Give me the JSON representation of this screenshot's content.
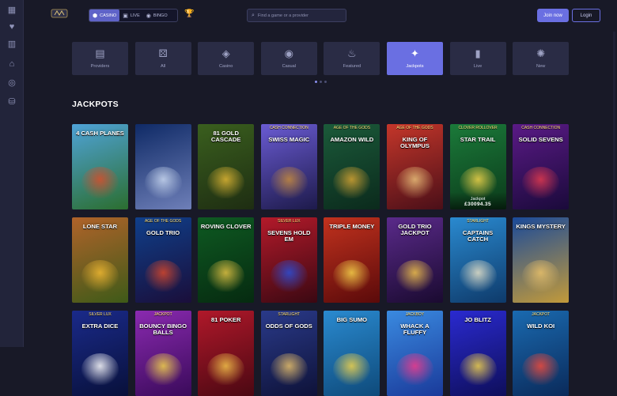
{
  "sidebar": {
    "icons": [
      "dashboard-icon",
      "heart-icon",
      "building-icon",
      "gift-icon",
      "chip-icon",
      "coins-icon"
    ]
  },
  "header": {
    "modes": [
      {
        "label": "CASINO",
        "icon": "casino-icon",
        "active": true
      },
      {
        "label": "LIVE",
        "icon": "cards-icon",
        "active": false
      },
      {
        "label": "BINGO",
        "icon": "bingo-icon",
        "active": false
      }
    ],
    "search_placeholder": "Find a game or a provider",
    "join_label": "Join now",
    "login_label": "Login"
  },
  "categories": [
    {
      "label": "Providers",
      "icon": "briefcase-icon",
      "active": false
    },
    {
      "label": "All",
      "icon": "dice-icon",
      "active": false
    },
    {
      "label": "Casino",
      "icon": "casino-chips-icon",
      "active": false
    },
    {
      "label": "Casual",
      "icon": "ball-icon",
      "active": false
    },
    {
      "label": "Featured",
      "icon": "flame-icon",
      "active": false
    },
    {
      "label": "Jackpots",
      "icon": "sparkle-icon",
      "active": true
    },
    {
      "label": "Live",
      "icon": "cards-icon",
      "active": false
    },
    {
      "label": "New",
      "icon": "party-icon",
      "active": false
    }
  ],
  "section_title": "JACKPOTS",
  "games": [
    {
      "title": "4 CASH PLANES",
      "subtitle": "",
      "bg": [
        "#4fa3d8",
        "#2b6e2f"
      ],
      "accent": "#d94d2a"
    },
    {
      "title": "",
      "subtitle": "",
      "bg": [
        "#0f2a66",
        "#6e7fb8"
      ],
      "accent": "#c9d8f0"
    },
    {
      "title": "81 GOLD CASCADE",
      "subtitle": "",
      "bg": [
        "#3a5f1e",
        "#1e2d12"
      ],
      "accent": "#e0b634"
    },
    {
      "title": "SWISS MAGIC",
      "subtitle": "CASH CONNECTION",
      "bg": [
        "#6a5bd3",
        "#1d1a4a"
      ],
      "accent": "#c68b3d"
    },
    {
      "title": "AMAZON WILD",
      "subtitle": "AGE OF THE GODS",
      "bg": [
        "#1b5a3a",
        "#0b2a1c"
      ],
      "accent": "#d6a433"
    },
    {
      "title": "KING OF OLYMPUS",
      "subtitle": "AGE OF THE GODS",
      "bg": [
        "#c4362a",
        "#4a0f18"
      ],
      "accent": "#e9c07a"
    },
    {
      "title": "STAR TRAIL",
      "subtitle": "CLOVER ROLLOVER",
      "bg": [
        "#1b7a3a",
        "#0b3a1a"
      ],
      "accent": "#f2d44a"
    },
    {
      "title": "SOLID SEVENS",
      "subtitle": "CASH CONNECTION",
      "bg": [
        "#5a1a86",
        "#1a0a3a"
      ],
      "accent": "#e23a4e"
    },
    {
      "title": "LONE STAR",
      "subtitle": "",
      "bg": [
        "#b0632a",
        "#3e5a18"
      ],
      "accent": "#f0b832"
    },
    {
      "title": "GOLD TRIO",
      "subtitle": "AGE OF THE GODS",
      "bg": [
        "#0f3f8a",
        "#1a0e3a"
      ],
      "accent": "#d8472a"
    },
    {
      "title": "ROVING CLOVER",
      "subtitle": "",
      "bg": [
        "#0e5a22",
        "#062a10"
      ],
      "accent": "#e4c243"
    },
    {
      "title": "SEVENS HOLD EM",
      "subtitle": "SILVER LUX",
      "bg": [
        "#b31a2a",
        "#3a0812"
      ],
      "accent": "#2a4fd8"
    },
    {
      "title": "TRIPLE MONEY",
      "subtitle": "",
      "bg": [
        "#c2321e",
        "#5a0a0a"
      ],
      "accent": "#f6d34a"
    },
    {
      "title": "GOLD TRIO JACKPOT",
      "subtitle": "",
      "bg": [
        "#5a2a8a",
        "#1a0a30"
      ],
      "accent": "#f2c34a"
    },
    {
      "title": "CAPTAINS CATCH",
      "subtitle": "STARLIGHT",
      "bg": [
        "#2a8ad0",
        "#0e3a6a"
      ],
      "accent": "#e8e2c8"
    },
    {
      "title": "KINGS MYSTERY",
      "subtitle": "",
      "bg": [
        "#1a4a9a",
        "#c29a3a"
      ],
      "accent": "#e8c06a"
    },
    {
      "title": "EXTRA DICE",
      "subtitle": "SILVER LUX",
      "bg": [
        "#1a2a8a",
        "#08103a"
      ],
      "accent": "#ffffff"
    },
    {
      "title": "BOUNCY BINGO BALLS",
      "subtitle": "JACKPOT",
      "bg": [
        "#8a2ab0",
        "#3a0a5a"
      ],
      "accent": "#f2d44a"
    },
    {
      "title": "81 POKER",
      "subtitle": "",
      "bg": [
        "#b0182a",
        "#4a0812"
      ],
      "accent": "#f2c34a"
    },
    {
      "title": "ODDS OF GODS",
      "subtitle": "STARLIGHT",
      "bg": [
        "#2a3a8a",
        "#0e1238"
      ],
      "accent": "#e8c06a"
    },
    {
      "title": "BIG SUMO",
      "subtitle": "",
      "bg": [
        "#2a8ad0",
        "#0e4a7a"
      ],
      "accent": "#f2d44a"
    },
    {
      "title": "WHACK A FLUFFY",
      "subtitle": "JACKBOY",
      "bg": [
        "#3a8ae0",
        "#1a3a9a"
      ],
      "accent": "#f23a8a"
    },
    {
      "title": "JO BLITZ",
      "subtitle": "",
      "bg": [
        "#2a2ad0",
        "#0e0e5a"
      ],
      "accent": "#f2d44a"
    },
    {
      "title": "WILD KOI",
      "subtitle": "JACKPOT",
      "bg": [
        "#1a6ab0",
        "#0a2a5a"
      ],
      "accent": "#f24a3a"
    }
  ],
  "jackpot_tile": {
    "index": 6,
    "label": "Jackpot",
    "value": "£30094.35"
  }
}
